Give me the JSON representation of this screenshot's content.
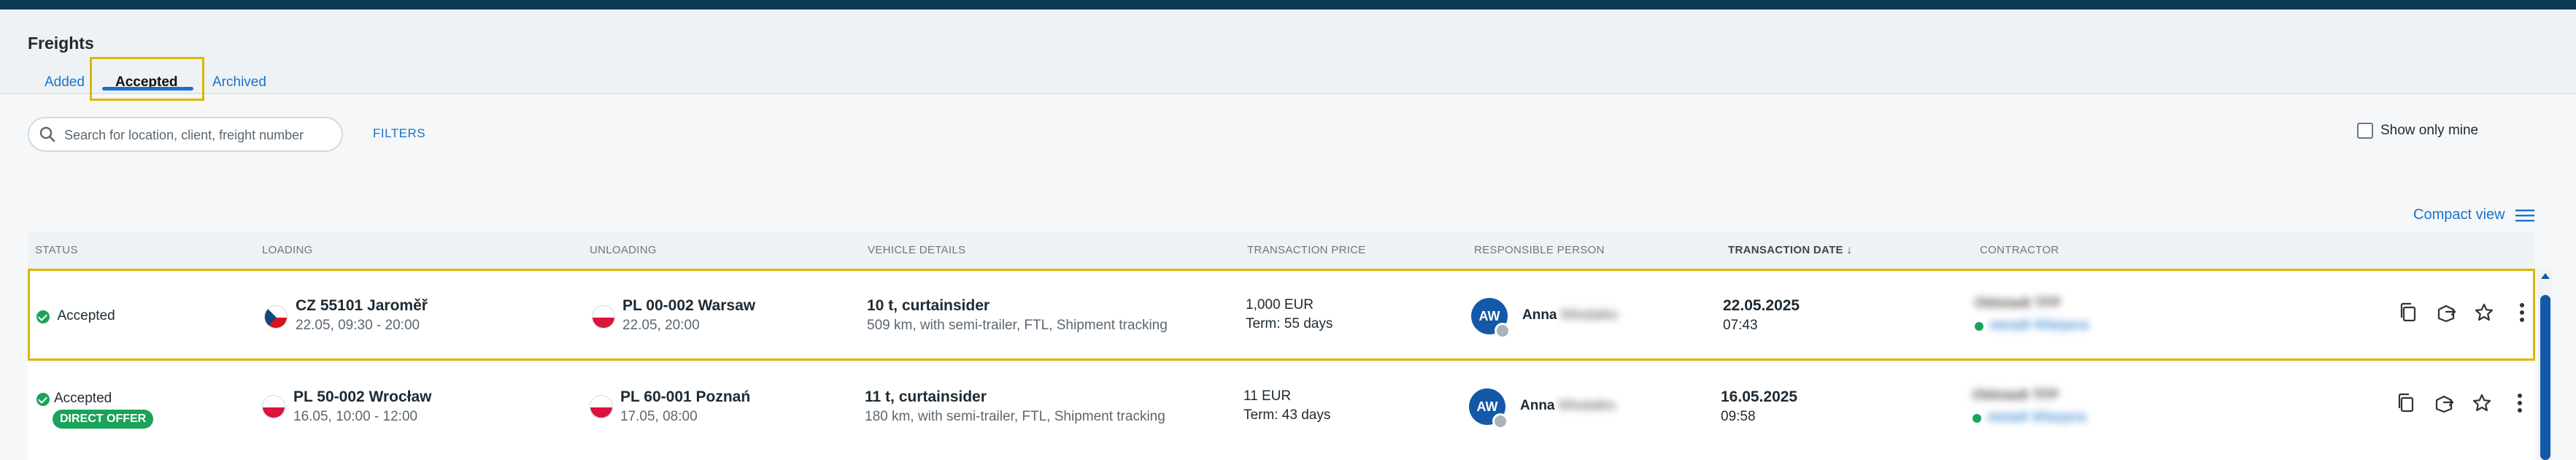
{
  "page": {
    "title": "Freights"
  },
  "tabs": [
    {
      "label": "Added"
    },
    {
      "label": "Accepted",
      "active": true
    },
    {
      "label": "Archived"
    }
  ],
  "search": {
    "placeholder": "Search for location, client, freight number",
    "value": ""
  },
  "filters_label": "FILTERS",
  "show_only_mine": {
    "label": "Show only mine",
    "checked": false
  },
  "compact_view_label": "Compact view",
  "columns": {
    "status": "STATUS",
    "loading": "LOADING",
    "unloading": "UNLOADING",
    "vehicle": "VEHICLE DETAILS",
    "price": "TRANSACTION PRICE",
    "person": "RESPONSIBLE PERSON",
    "date": "TRANSACTION DATE ↓",
    "contractor": "CONTRACTOR"
  },
  "rows": [
    {
      "status": "Accepted",
      "badge": "",
      "loading_place": "CZ 55101 Jaroměř",
      "loading_time": "22.05, 09:30 - 20:00",
      "unloading_place": "PL 00-002 Warsaw",
      "unloading_time": "22.05, 20:00",
      "vehicle_main": "10 t, curtainsider",
      "vehicle_sub": "509 km, with semi-trailer, FTL, Shipment tracking",
      "price": "1,000 EUR",
      "term_label": "Term:",
      "term_value": "55 days",
      "avatar": "AW",
      "person_first": "Anna",
      "person_last": "Wlodatko",
      "date": "22.05.2025",
      "time": "07:43",
      "contractor_name": "Oldstadt TFP",
      "contractor_contact": "steiadt Wlarjana"
    },
    {
      "status": "Accepted",
      "badge": "DIRECT OFFER",
      "loading_place": "PL 50-002 Wrocław",
      "loading_time": "16.05, 10:00 - 12:00",
      "unloading_place": "PL 60-001 Poznań",
      "unloading_time": "17.05, 08:00",
      "vehicle_main": "11 t, curtainsider",
      "vehicle_sub": "180 km, with semi-trailer, FTL, Shipment tracking",
      "price": "11 EUR",
      "term_label": "Term:",
      "term_value": "43 days",
      "avatar": "AW",
      "person_first": "Anna",
      "person_last": "Wlodatko",
      "date": "16.05.2025",
      "time": "09:58",
      "contractor_name": "Oldstadt TFP",
      "contractor_contact": "steiadt Wlarjana"
    }
  ],
  "colors": {
    "accent": "#1a73c9",
    "highlight": "#d8b800",
    "success": "#1aa35a",
    "avatar": "#1458a8"
  },
  "icons": [
    "search-icon",
    "list-view-icon",
    "copy-icon",
    "share-icon",
    "star-icon",
    "more-vertical-icon",
    "czech-flag-icon",
    "polish-flag-icon"
  ]
}
